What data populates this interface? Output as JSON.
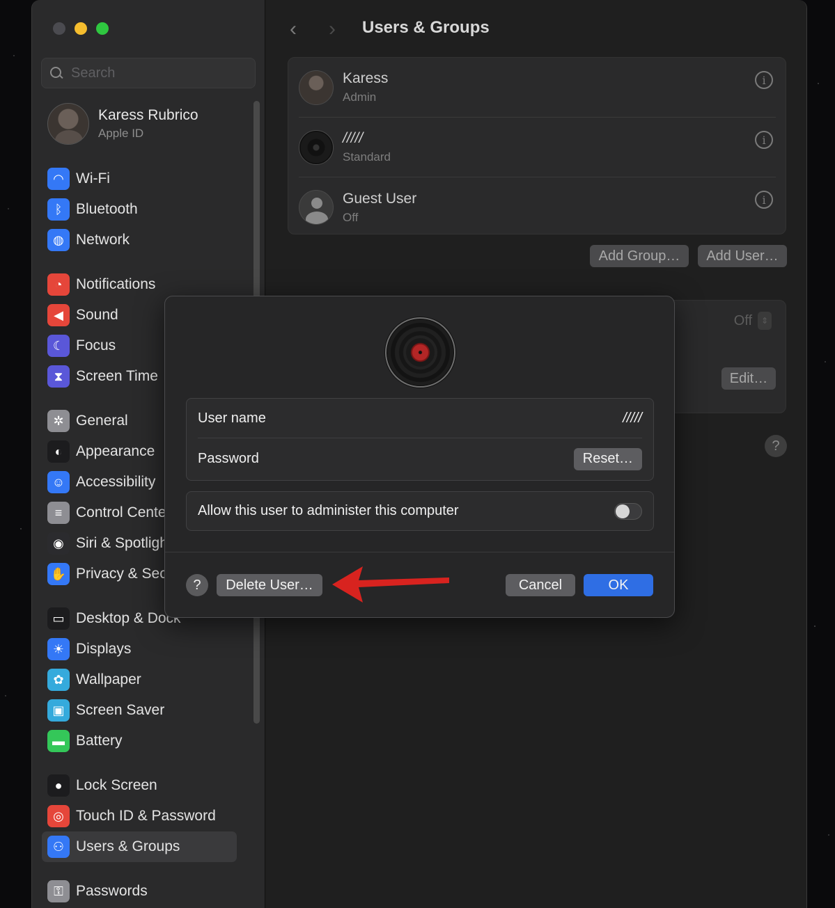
{
  "search": {
    "placeholder": "Search"
  },
  "profile": {
    "name": "Karess Rubrico",
    "subtitle": "Apple ID"
  },
  "sidebar": {
    "items": [
      {
        "label": "Wi-Fi",
        "icon": "wifi-icon",
        "color": "#3478f6"
      },
      {
        "label": "Bluetooth",
        "icon": "bluetooth-icon",
        "color": "#3478f6"
      },
      {
        "label": "Network",
        "icon": "globe-icon",
        "color": "#3478f6"
      },
      {
        "label": "Notifications",
        "icon": "bell-icon",
        "color": "#e5463a"
      },
      {
        "label": "Sound",
        "icon": "speaker-icon",
        "color": "#e5463a"
      },
      {
        "label": "Focus",
        "icon": "moon-icon",
        "color": "#5a57d8"
      },
      {
        "label": "Screen Time",
        "icon": "hourglass-icon",
        "color": "#5a57d8"
      },
      {
        "label": "General",
        "icon": "gear-icon",
        "color": "#8e8e93"
      },
      {
        "label": "Appearance",
        "icon": "appearance-icon",
        "color": "#1c1c1e"
      },
      {
        "label": "Accessibility",
        "icon": "accessibility-icon",
        "color": "#3478f6"
      },
      {
        "label": "Control Center",
        "icon": "toggles-icon",
        "color": "#8e8e93"
      },
      {
        "label": "Siri & Spotlight",
        "icon": "siri-icon",
        "color": "#2b2b2e"
      },
      {
        "label": "Privacy & Security",
        "icon": "hand-icon",
        "color": "#3478f6"
      },
      {
        "label": "Desktop & Dock",
        "icon": "dock-icon",
        "color": "#1c1c1e"
      },
      {
        "label": "Displays",
        "icon": "sun-icon",
        "color": "#3478f6"
      },
      {
        "label": "Wallpaper",
        "icon": "flower-icon",
        "color": "#35aadc"
      },
      {
        "label": "Screen Saver",
        "icon": "screensaver-icon",
        "color": "#35aadc"
      },
      {
        "label": "Battery",
        "icon": "battery-icon",
        "color": "#34c759"
      },
      {
        "label": "Lock Screen",
        "icon": "lock-icon",
        "color": "#1c1c1e"
      },
      {
        "label": "Touch ID & Password",
        "icon": "fingerprint-icon",
        "color": "#e5463a"
      },
      {
        "label": "Users & Groups",
        "icon": "users-icon",
        "color": "#3478f6"
      },
      {
        "label": "Passwords",
        "icon": "key-icon",
        "color": "#8e8e93"
      }
    ]
  },
  "main": {
    "title": "Users & Groups",
    "users": [
      {
        "name": "Karess",
        "role": "Admin"
      },
      {
        "name": "/////",
        "role": "Standard"
      },
      {
        "name": "Guest User",
        "role": "Off"
      }
    ],
    "add_group_label": "Add Group…",
    "add_user_label": "Add User…",
    "auto_login_value": "Off",
    "edit_label": "Edit…"
  },
  "dialog": {
    "username_label": "User name",
    "username_value": "/////",
    "password_label": "Password",
    "reset_label": "Reset…",
    "admin_label": "Allow this user to administer this computer",
    "admin_enabled": false,
    "delete_label": "Delete User…",
    "cancel_label": "Cancel",
    "ok_label": "OK",
    "help_glyph": "?"
  },
  "colors": {
    "accent": "#2f6ee4",
    "annotation_arrow": "#d8231f"
  }
}
